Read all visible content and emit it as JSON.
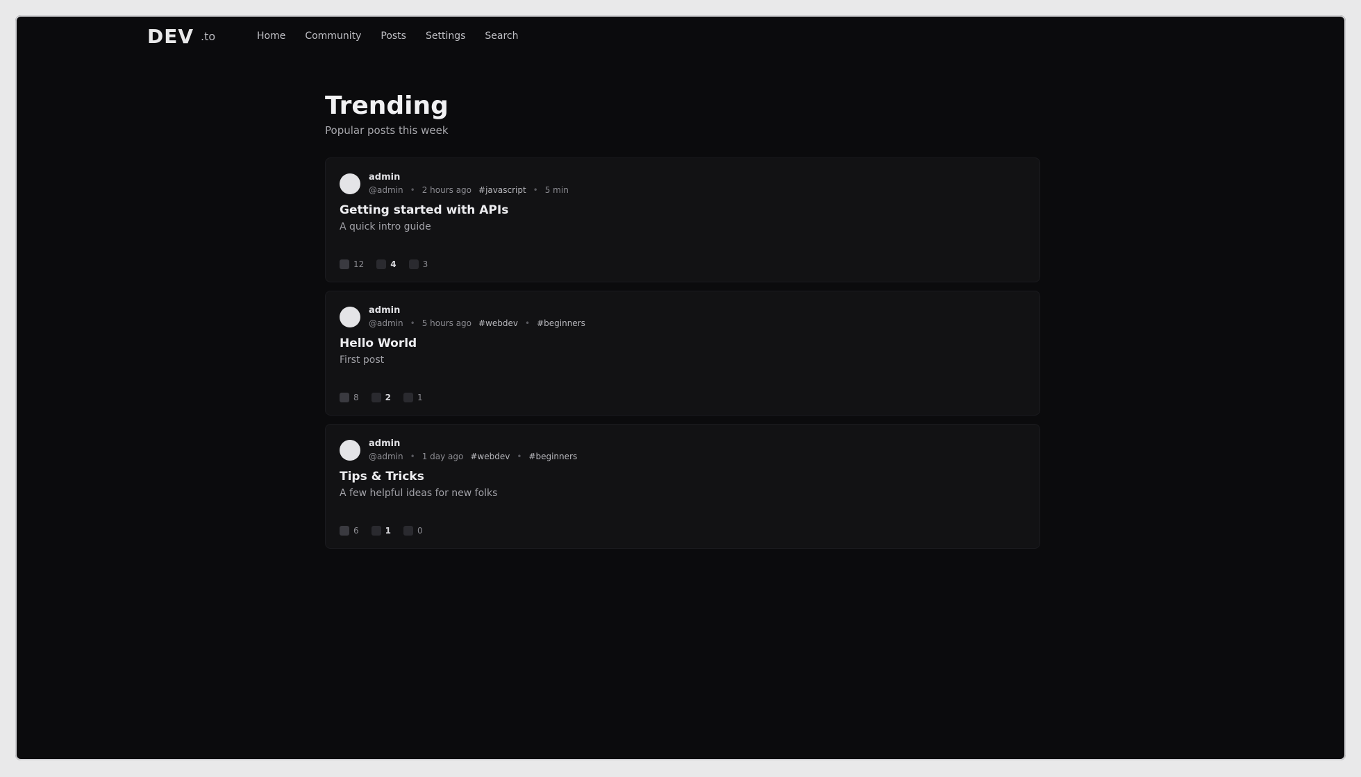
{
  "app": {
    "brand": "DEV",
    "brand_suffix": ".to",
    "nav": [
      "Home",
      "Community",
      "Posts",
      "Settings",
      "Search"
    ]
  },
  "page": {
    "title": "Trending",
    "subtitle": "Popular posts this week"
  },
  "posts": [
    {
      "author": "admin",
      "meta": {
        "handle": "@admin",
        "time": "2 hours ago",
        "tag": "#javascript",
        "extra": "5 min"
      },
      "title": "Getting started with APIs",
      "snippet": "A quick intro guide",
      "actions": {
        "upvote": "12",
        "score": "4",
        "comments": "3"
      }
    },
    {
      "author": "admin",
      "meta": {
        "handle": "@admin",
        "time": "5 hours ago",
        "tag": "#webdev",
        "extra": "#beginners"
      },
      "title": "Hello World",
      "snippet": "First post",
      "actions": {
        "upvote": "8",
        "score": "2",
        "comments": "1"
      }
    },
    {
      "author": "admin",
      "meta": {
        "handle": "@admin",
        "time": "1 day ago",
        "tag": "#webdev",
        "extra": "#beginners"
      },
      "title": "Tips & Tricks",
      "snippet": "A few helpful ideas for new folks",
      "actions": {
        "upvote": "6",
        "score": "1",
        "comments": "0"
      }
    }
  ]
}
